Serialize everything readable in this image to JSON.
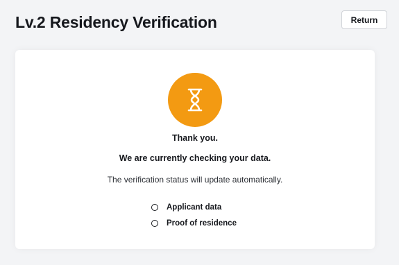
{
  "header": {
    "title": "Lv.2 Residency Verification",
    "return_label": "Return"
  },
  "status": {
    "icon": "hourglass-icon",
    "icon_color": "#f39a12",
    "thank_you": "Thank you.",
    "checking": "We are currently checking your data.",
    "auto_update": "The verification status will update automatically."
  },
  "checklist": [
    {
      "label": "Applicant data"
    },
    {
      "label": "Proof of residence"
    }
  ]
}
